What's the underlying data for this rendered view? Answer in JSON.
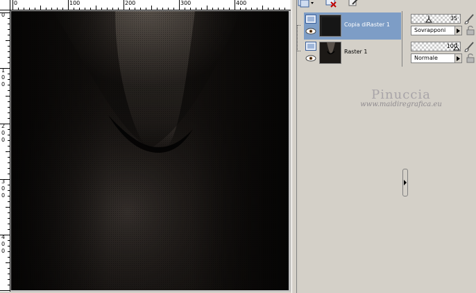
{
  "ruler": {
    "top_labels": [
      "0",
      "100",
      "200",
      "300",
      "400"
    ],
    "left_labels": [
      "0",
      "1\n0\n0",
      "2\n0\n0",
      "3\n0\n0",
      "4\n0\n0"
    ]
  },
  "layers": [
    {
      "name": "Copia diRaster 1",
      "opacity": "35",
      "blend_mode": "Sovrapponi",
      "selected": true,
      "visible": true
    },
    {
      "name": "Raster 1",
      "opacity": "100",
      "blend_mode": "Normale",
      "selected": false,
      "visible": true
    }
  ],
  "icons": {
    "toolbar_new_layer": "new-layer-icon",
    "toolbar_dropdown": "chevron-down-icon",
    "toolbar_delete": "delete-layer-icon",
    "toolbar_edit": "edit-icon",
    "layer_type": "raster-layer-icon",
    "visibility": "eye-icon",
    "brush": "brush-icon",
    "lock": "lock-icon",
    "dropdown": "chevron-right-icon"
  },
  "watermark": {
    "title": "Pinuccia",
    "url": "www.maidiregrafica.eu"
  },
  "colors": {
    "selection": "#7d9dc6",
    "panel_bg": "#d4d0c8",
    "canvas_dark": "#0d0b09"
  }
}
